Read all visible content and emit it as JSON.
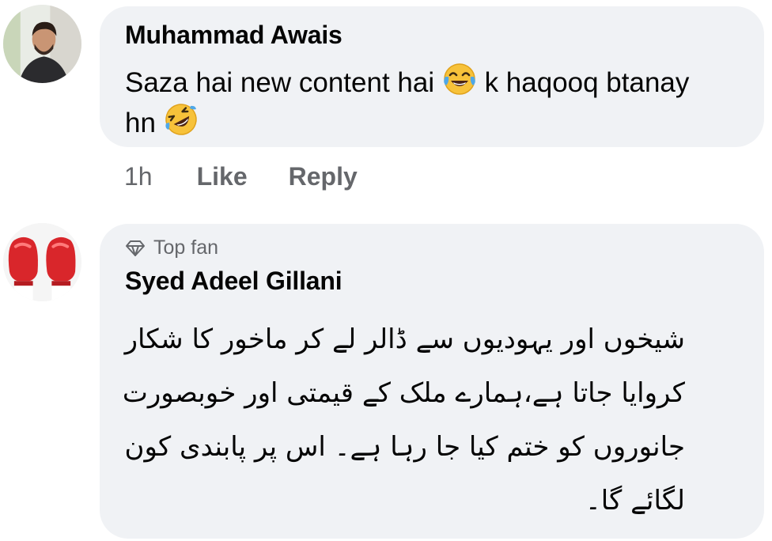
{
  "comments": [
    {
      "author": "Muhammad Awais",
      "text_before_emoji": "Saza hai new content hai",
      "emoji_1": "face-with-tears-of-joy-icon",
      "text_middle": " k haqooq btanay hn ",
      "emoji_2": "rolling-on-floor-laughing-icon",
      "time": "1h",
      "like_label": "Like",
      "reply_label": "Reply"
    },
    {
      "badge": "Top fan",
      "badge_icon": "diamond-icon",
      "author": "Syed Adeel Gillani",
      "text": "شیخوں اور یہودیوں سے ڈالر لے کر ماخور کا شکار کروایا جاتا ہے،ہمارے ملک کے قیمتی اور خوبصورت جانوروں کو ختم کیا جا رہا ہے۔ اس پر پابندی کون لگائے گا۔"
    }
  ],
  "colors": {
    "bubble": "#f0f2f5",
    "secondary_text": "#65676b",
    "primary_text": "#050505"
  }
}
